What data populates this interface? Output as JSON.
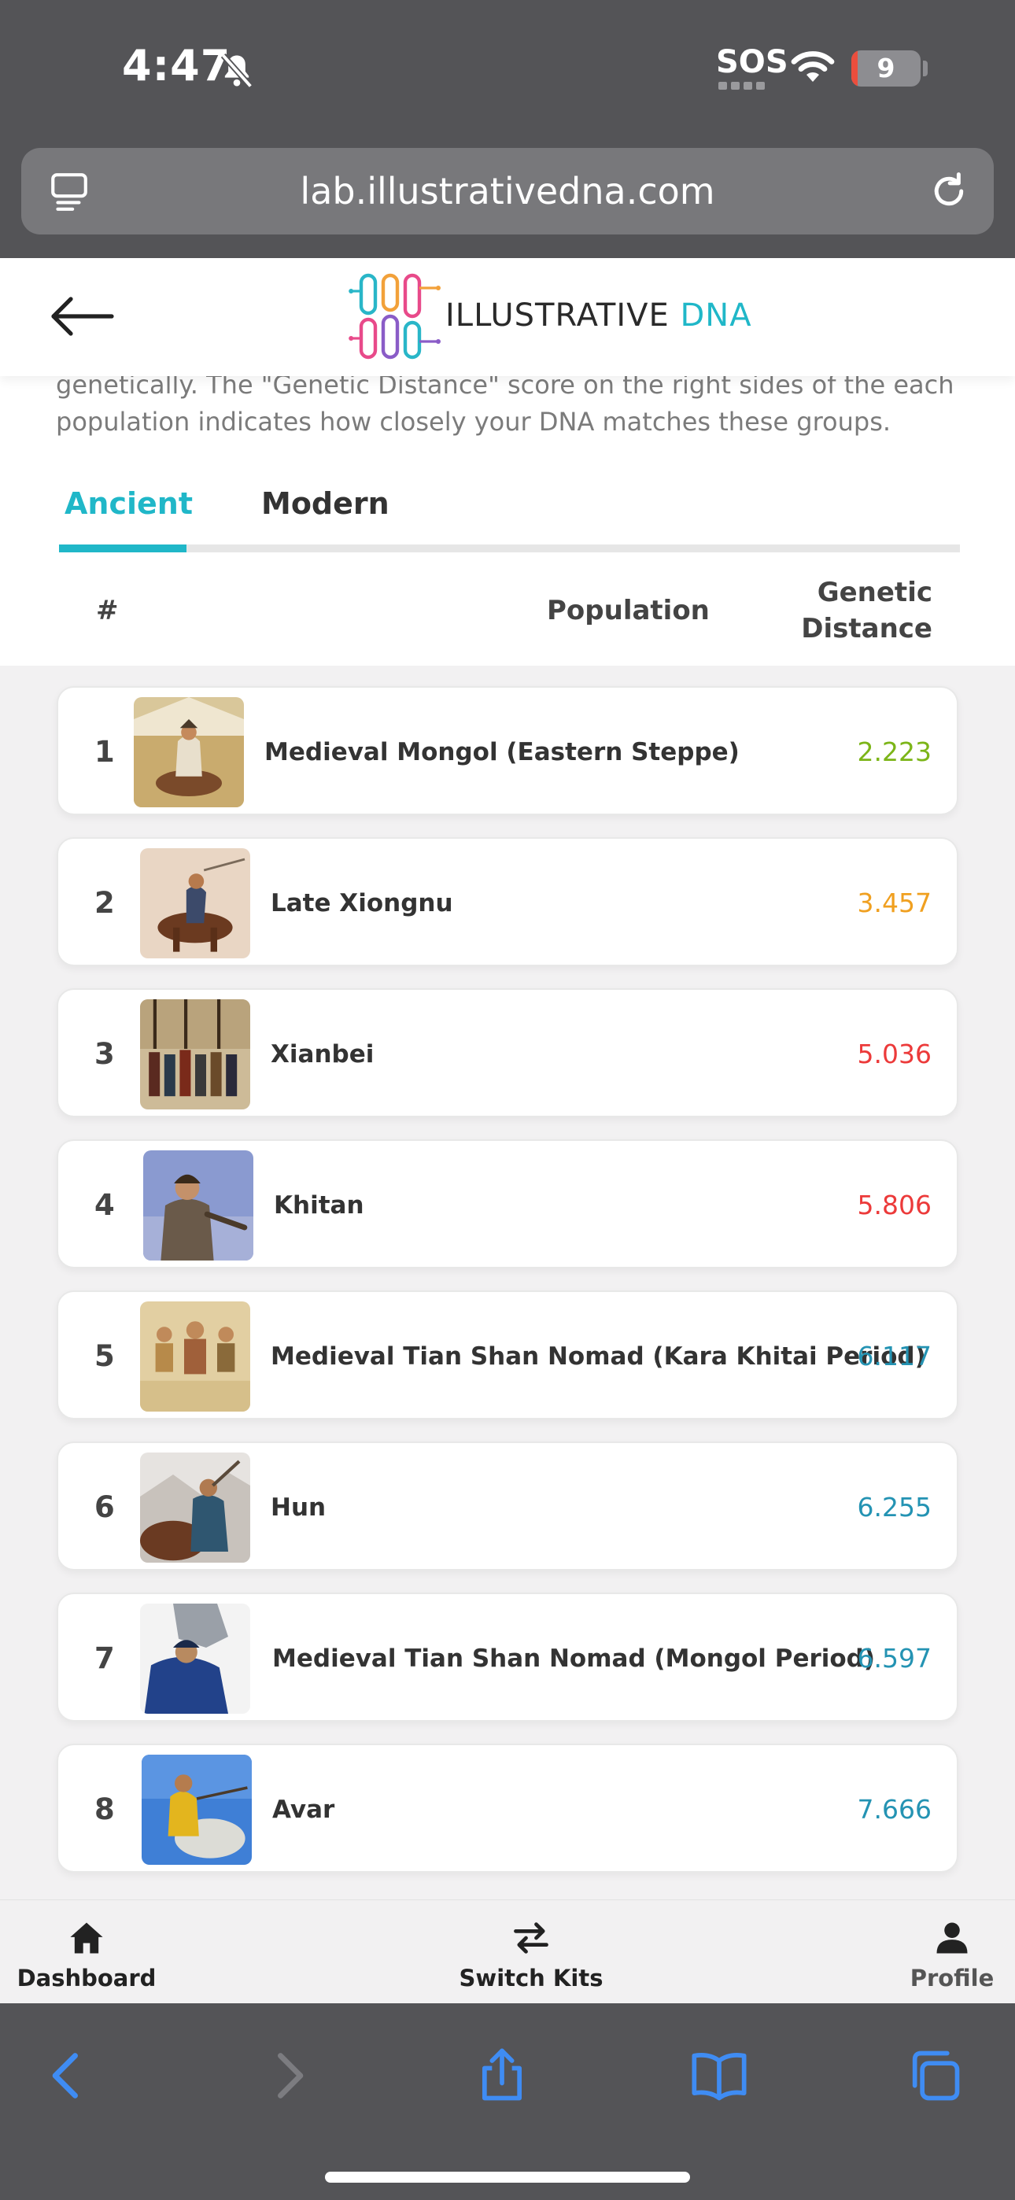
{
  "status_bar": {
    "time": "4:47",
    "sos": "SOS",
    "battery": "9",
    "battery_level": 0.09
  },
  "browser": {
    "url": "lab.illustrativedna.com"
  },
  "header": {
    "logo_text": "ILLUSTRATIVE ",
    "logo_accent": "DNA"
  },
  "intro": {
    "text": "genetically. The \"Genetic Distance\" score on the right sides of the each population indicates how closely your DNA matches these groups."
  },
  "tabs": [
    {
      "label": "Ancient",
      "active": true
    },
    {
      "label": "Modern",
      "active": false
    }
  ],
  "table": {
    "headers": {
      "rank": "#",
      "population": "Population",
      "distance": "Genetic Distance"
    },
    "rows": [
      {
        "rank": "1",
        "name": "Medieval Mongol (Eastern Steppe)",
        "score": "2.223",
        "color": "#7cb518"
      },
      {
        "rank": "2",
        "name": "Late Xiongnu",
        "score": "3.457",
        "color": "#f0a020"
      },
      {
        "rank": "3",
        "name": "Xianbei",
        "score": "5.036",
        "color": "#ec3a3a"
      },
      {
        "rank": "4",
        "name": "Khitan",
        "score": "5.806",
        "color": "#ec3a3a"
      },
      {
        "rank": "5",
        "name": "Medieval Tian Shan Nomad (Kara Khitai Period)",
        "score": "6.117",
        "color": "#2493b3"
      },
      {
        "rank": "6",
        "name": "Hun",
        "score": "6.255",
        "color": "#2493b3"
      },
      {
        "rank": "7",
        "name": "Medieval Tian Shan Nomad (Mongol Period)",
        "score": "6.597",
        "color": "#2493b3"
      },
      {
        "rank": "8",
        "name": "Avar",
        "score": "7.666",
        "color": "#2493b3"
      }
    ]
  },
  "bottom_nav": [
    {
      "label": "Dashboard",
      "icon": "home-icon"
    },
    {
      "label": "Switch Kits",
      "icon": "switch-arrows-icon"
    },
    {
      "label": "Profile",
      "icon": "person-icon"
    }
  ],
  "safari_toolbar": [
    "back-icon",
    "forward-icon",
    "share-icon",
    "bookmarks-icon",
    "tabs-icon"
  ],
  "colors": {
    "accent": "#20b7c8",
    "browser_chrome": "#545457",
    "safari_blue": "#3f8cf3"
  }
}
